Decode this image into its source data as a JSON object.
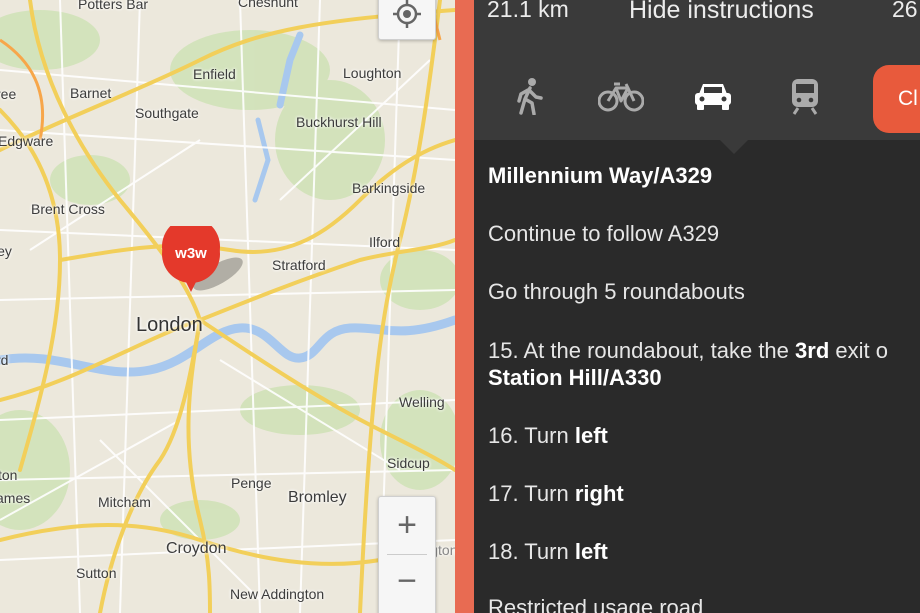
{
  "map": {
    "places": [
      {
        "label": "Potters Bar",
        "size": "sm"
      },
      {
        "label": "Cheshunt",
        "size": "sm"
      },
      {
        "label": "Enfield",
        "size": "sm"
      },
      {
        "label": "Loughton",
        "size": "sm"
      },
      {
        "label": "Barnet",
        "size": "sm"
      },
      {
        "label": "Southgate",
        "size": "sm"
      },
      {
        "label": "Buckhurst Hill",
        "size": "sm"
      },
      {
        "label": "Edgware",
        "size": "sm"
      },
      {
        "label": "Barkingside",
        "size": "sm"
      },
      {
        "label": "Brent Cross",
        "size": "sm"
      },
      {
        "label": "Ilford",
        "size": "sm"
      },
      {
        "label": "Stratford",
        "size": "sm"
      },
      {
        "label": "London",
        "size": "big"
      },
      {
        "label": "Welling",
        "size": "sm"
      },
      {
        "label": "Sidcup",
        "size": "sm"
      },
      {
        "label": "Penge",
        "size": "sm"
      },
      {
        "label": "Bromley",
        "size": "sm"
      },
      {
        "label": "Mitcham",
        "size": "sm"
      },
      {
        "label": "Croydon",
        "size": "sm"
      },
      {
        "label": "Orpington",
        "size": "sm"
      },
      {
        "label": "Sutton",
        "size": "sm"
      },
      {
        "label": "New Addington",
        "size": "sm"
      },
      {
        "label": "ley",
        "size": "sm"
      },
      {
        "label": "ree",
        "size": "sm"
      },
      {
        "label": "rd",
        "size": "sm"
      },
      {
        "label": "ton",
        "size": "sm"
      },
      {
        "label": "ames",
        "size": "sm"
      }
    ],
    "pin_label": "w3w",
    "zoom_in_label": "+",
    "zoom_out_label": "−",
    "locate_icon": "my-location-icon"
  },
  "panel": {
    "distance": "21.1 km",
    "hide_instructions": "Hide instructions",
    "duration": "26",
    "modes": [
      {
        "name": "walking",
        "icon": "walk-icon",
        "active": false
      },
      {
        "name": "cycling",
        "icon": "bicycle-icon",
        "active": false
      },
      {
        "name": "driving",
        "icon": "car-icon",
        "active": true
      },
      {
        "name": "transit",
        "icon": "train-icon",
        "active": false
      }
    ],
    "close_label": "Cl",
    "steps": {
      "step_a_bold": "Millennium Way/A329",
      "step_b": "Continue to follow A329",
      "step_c": "Go through 5 roundabouts",
      "step_15_pre": "15. At the roundabout, take the ",
      "step_15_bold": "3rd",
      "step_15_post": " exit o",
      "step_15_line2_bold": "Station Hill/A330",
      "step_16_pre": "16. Turn ",
      "step_16_bold": "left",
      "step_17_pre": "17. Turn ",
      "step_17_bold": "right",
      "step_18_pre": "18. Turn ",
      "step_18_bold": "left",
      "step_last": "Restricted usage road"
    }
  },
  "colors": {
    "accent": "#e85a3c",
    "divider": "#e86b52",
    "panel_bg": "#2a2a2a",
    "topbar_bg": "#3a3a3a",
    "road_major": "#f2cf5a",
    "road_minor": "#ffffff",
    "water": "#a8c8ee",
    "park": "#c8dfae"
  }
}
